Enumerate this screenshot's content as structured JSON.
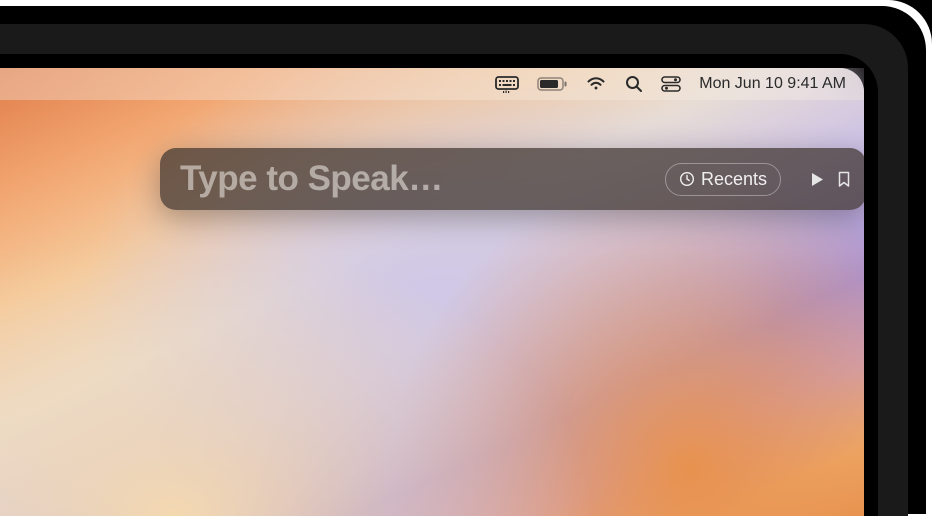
{
  "menubar": {
    "datetime": "Mon Jun 10  9:41 AM"
  },
  "panel": {
    "placeholder": "Type to Speak…",
    "recents_label": "Recents"
  }
}
